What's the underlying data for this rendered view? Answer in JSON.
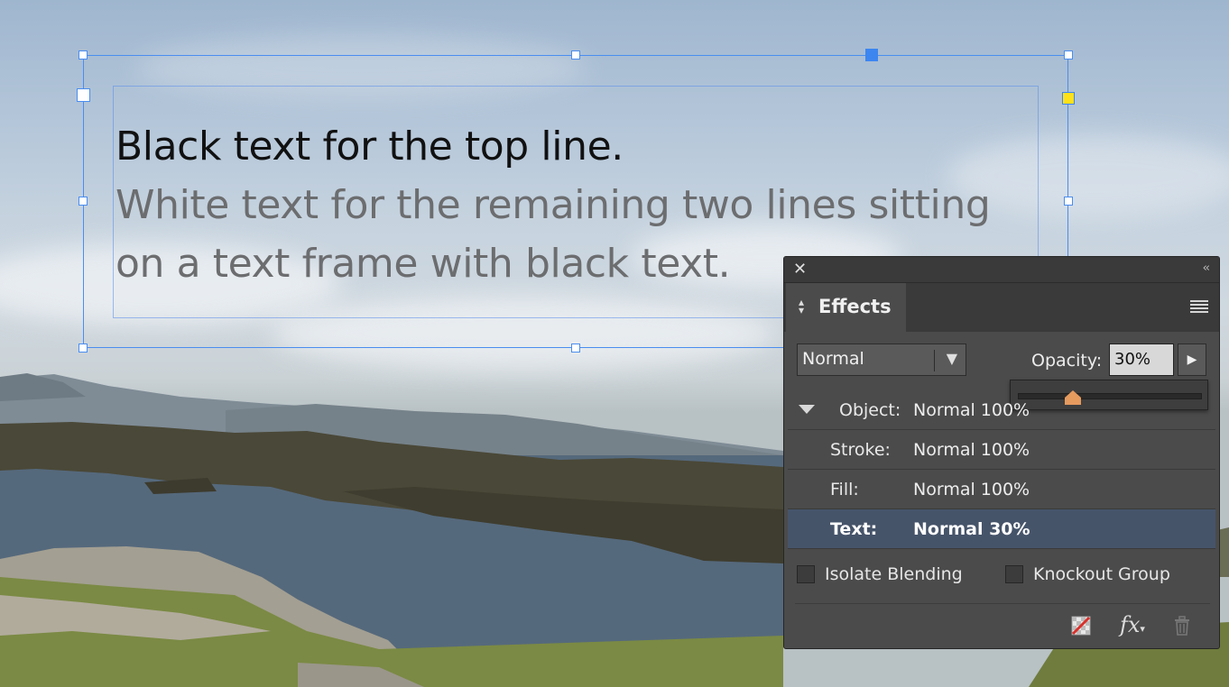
{
  "canvas": {
    "story": {
      "line1": "Black text for the top line.",
      "line2": "White text for the remaining two lines sitting",
      "line3": "on a text frame with black text."
    }
  },
  "effects_panel": {
    "tab_label": "Effects",
    "blend_mode": "Normal",
    "opacity_label": "Opacity:",
    "opacity_value": "30%",
    "opacity_slider_fraction": 0.3,
    "rows": [
      {
        "label": "Object:",
        "value": "Normal 100%"
      },
      {
        "label": "Stroke:",
        "value": "Normal 100%"
      },
      {
        "label": "Fill:",
        "value": "Normal 100%"
      },
      {
        "label": "Text:",
        "value": "Normal 30%"
      }
    ],
    "isolate_blending_label": "Isolate Blending",
    "isolate_blending_checked": false,
    "knockout_group_label": "Knockout Group",
    "knockout_group_checked": false,
    "footer_icons": [
      "clear-effects-icon",
      "fx-icon",
      "trash-icon"
    ]
  },
  "colors": {
    "selection": "#4a8df0",
    "panel_bg": "#4b4b4b",
    "selected_row": "#46546a",
    "slider_thumb": "#e59a5e"
  }
}
